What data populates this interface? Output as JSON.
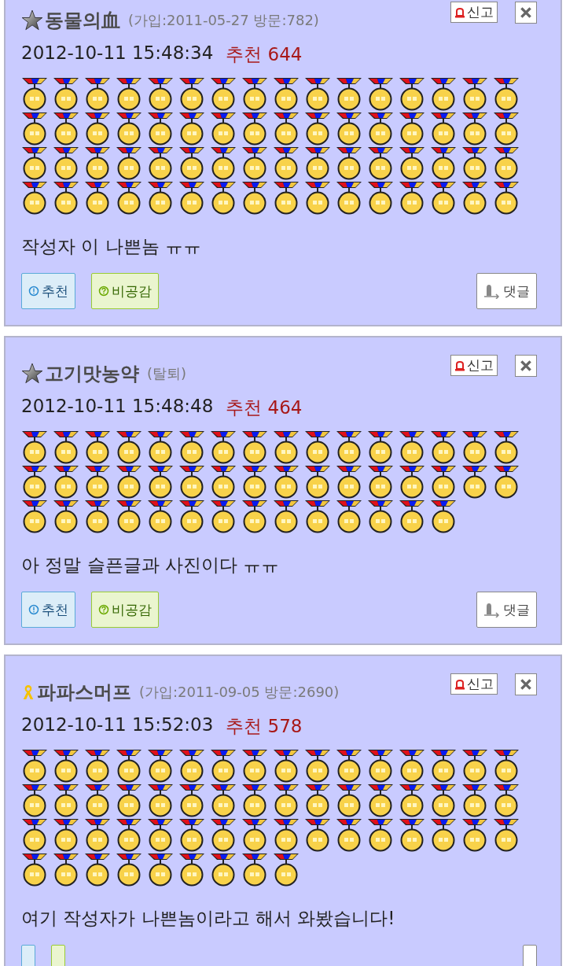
{
  "posts": [
    {
      "kind": "star",
      "author": "동물의血",
      "meta": "(가입:2011-05-27 방문:782)",
      "report": "신고",
      "date": "2012-10-11 15:48:34",
      "recommend": "추천 644",
      "body": "작성자 이 나쁜놈 ㅠㅠ",
      "medals": [
        {
          "kind": "gold"
        },
        {
          "kind": "gold"
        },
        {
          "kind": "gold"
        },
        {
          "kind": "gold"
        },
        {
          "kind": "gold"
        },
        {
          "kind": "gold"
        },
        {
          "kind": "gold"
        },
        {
          "kind": "gold"
        },
        {
          "kind": "gold"
        },
        {
          "kind": "gold"
        },
        {
          "kind": "gold"
        },
        {
          "kind": "gold"
        },
        {
          "kind": "gold"
        },
        {
          "kind": "gold"
        },
        {
          "kind": "gold"
        },
        {
          "kind": "gold"
        },
        {
          "kind": "gold"
        },
        {
          "kind": "gold"
        },
        {
          "kind": "gold"
        },
        {
          "kind": "gold"
        },
        {
          "kind": "gold"
        },
        {
          "kind": "gold"
        },
        {
          "kind": "gold"
        },
        {
          "kind": "gold"
        },
        {
          "kind": "gold"
        },
        {
          "kind": "gold"
        },
        {
          "kind": "gold"
        },
        {
          "kind": "gold"
        },
        {
          "kind": "gold"
        },
        {
          "kind": "gold"
        },
        {
          "kind": "gold"
        },
        {
          "kind": "gold"
        },
        {
          "kind": "gold"
        },
        {
          "kind": "gold"
        },
        {
          "kind": "gold"
        },
        {
          "kind": "gold"
        },
        {
          "kind": "gold"
        },
        {
          "kind": "gold"
        },
        {
          "kind": "gold"
        },
        {
          "kind": "gold"
        },
        {
          "kind": "gold"
        },
        {
          "kind": "gold"
        },
        {
          "kind": "gold"
        },
        {
          "kind": "gold"
        },
        {
          "kind": "gold"
        },
        {
          "kind": "gold"
        },
        {
          "kind": "gold"
        },
        {
          "kind": "gold"
        },
        {
          "kind": "gold"
        },
        {
          "kind": "gold"
        },
        {
          "kind": "gold"
        },
        {
          "kind": "gold"
        },
        {
          "kind": "gold"
        },
        {
          "kind": "gold"
        },
        {
          "kind": "gold"
        },
        {
          "kind": "gold"
        },
        {
          "kind": "gold"
        },
        {
          "kind": "gold"
        },
        {
          "kind": "gold"
        },
        {
          "kind": "gold"
        },
        {
          "kind": "gold"
        },
        {
          "kind": "gold"
        },
        {
          "kind": "gold"
        },
        {
          "kind": "gold"
        }
      ],
      "buttons": [
        {
          "kind": "like",
          "label": "추천"
        },
        {
          "kind": "dislike",
          "label": "비공감"
        },
        {
          "kind": "reply",
          "label": "댓글"
        }
      ]
    },
    {
      "kind": "star",
      "author": "고기맛농약",
      "meta": "(탈퇴)",
      "report": "신고",
      "date": "2012-10-11 15:48:48",
      "recommend": "추천 464",
      "body": "아 정말 슬픈글과 사진이다 ㅠㅠ",
      "medals": [
        {
          "kind": "gold"
        },
        {
          "kind": "gold"
        },
        {
          "kind": "gold"
        },
        {
          "kind": "gold"
        },
        {
          "kind": "gold"
        },
        {
          "kind": "gold"
        },
        {
          "kind": "gold"
        },
        {
          "kind": "gold"
        },
        {
          "kind": "gold"
        },
        {
          "kind": "gold"
        },
        {
          "kind": "gold"
        },
        {
          "kind": "gold"
        },
        {
          "kind": "gold"
        },
        {
          "kind": "gold"
        },
        {
          "kind": "gold"
        },
        {
          "kind": "gold"
        },
        {
          "kind": "gold"
        },
        {
          "kind": "gold"
        },
        {
          "kind": "gold"
        },
        {
          "kind": "gold"
        },
        {
          "kind": "gold"
        },
        {
          "kind": "gold"
        },
        {
          "kind": "gold"
        },
        {
          "kind": "gold"
        },
        {
          "kind": "gold"
        },
        {
          "kind": "gold"
        },
        {
          "kind": "gold"
        },
        {
          "kind": "gold"
        },
        {
          "kind": "gold"
        },
        {
          "kind": "gold"
        },
        {
          "kind": "gold"
        },
        {
          "kind": "gold"
        },
        {
          "kind": "gold"
        },
        {
          "kind": "gold"
        },
        {
          "kind": "gold"
        },
        {
          "kind": "gold"
        },
        {
          "kind": "gold"
        },
        {
          "kind": "gold"
        },
        {
          "kind": "gold"
        },
        {
          "kind": "gold"
        },
        {
          "kind": "gold"
        },
        {
          "kind": "gold"
        },
        {
          "kind": "gold"
        },
        {
          "kind": "gold"
        },
        {
          "kind": "gold"
        },
        {
          "kind": "gold"
        }
      ],
      "buttons": [
        {
          "kind": "like",
          "label": "추천"
        },
        {
          "kind": "dislike",
          "label": "비공감"
        },
        {
          "kind": "reply",
          "label": "댓글"
        }
      ]
    },
    {
      "kind": "ribbon",
      "author": "파파스머프",
      "meta": "(가입:2011-09-05 방문:2690)",
      "report": "신고",
      "date": "2012-10-11 15:52:03",
      "recommend": "추천 578",
      "body": "여기 작성자가 나쁜놈이라고 해서 와봤습니다!",
      "medals": [
        {
          "kind": "gold"
        },
        {
          "kind": "gold"
        },
        {
          "kind": "gold"
        },
        {
          "kind": "gold"
        },
        {
          "kind": "gold"
        },
        {
          "kind": "gold"
        },
        {
          "kind": "gold"
        },
        {
          "kind": "gold"
        },
        {
          "kind": "gold"
        },
        {
          "kind": "gold"
        },
        {
          "kind": "gold"
        },
        {
          "kind": "gold"
        },
        {
          "kind": "gold"
        },
        {
          "kind": "gold"
        },
        {
          "kind": "gold"
        },
        {
          "kind": "gold"
        },
        {
          "kind": "gold"
        },
        {
          "kind": "gold"
        },
        {
          "kind": "gold"
        },
        {
          "kind": "gold"
        },
        {
          "kind": "gold"
        },
        {
          "kind": "gold"
        },
        {
          "kind": "gold"
        },
        {
          "kind": "gold"
        },
        {
          "kind": "gold"
        },
        {
          "kind": "gold"
        },
        {
          "kind": "gold"
        },
        {
          "kind": "gold"
        },
        {
          "kind": "gold"
        },
        {
          "kind": "gold"
        },
        {
          "kind": "gold"
        },
        {
          "kind": "gold"
        },
        {
          "kind": "gold"
        },
        {
          "kind": "gold"
        },
        {
          "kind": "gold"
        },
        {
          "kind": "gold"
        },
        {
          "kind": "gold"
        },
        {
          "kind": "gold"
        },
        {
          "kind": "gold"
        },
        {
          "kind": "gold"
        },
        {
          "kind": "gold"
        },
        {
          "kind": "gold"
        },
        {
          "kind": "gold"
        },
        {
          "kind": "gold"
        },
        {
          "kind": "gold"
        },
        {
          "kind": "gold"
        },
        {
          "kind": "gold"
        },
        {
          "kind": "gold"
        },
        {
          "kind": "gold"
        },
        {
          "kind": "gold"
        },
        {
          "kind": "gold"
        },
        {
          "kind": "gold"
        },
        {
          "kind": "gold"
        },
        {
          "kind": "gold"
        },
        {
          "kind": "gold"
        },
        {
          "kind": "gold"
        },
        {
          "kind": "gold"
        }
      ],
      "buttons": [
        {
          "kind": "like"
        },
        {
          "kind": "dislike"
        },
        {
          "kind": "reply"
        }
      ]
    }
  ]
}
